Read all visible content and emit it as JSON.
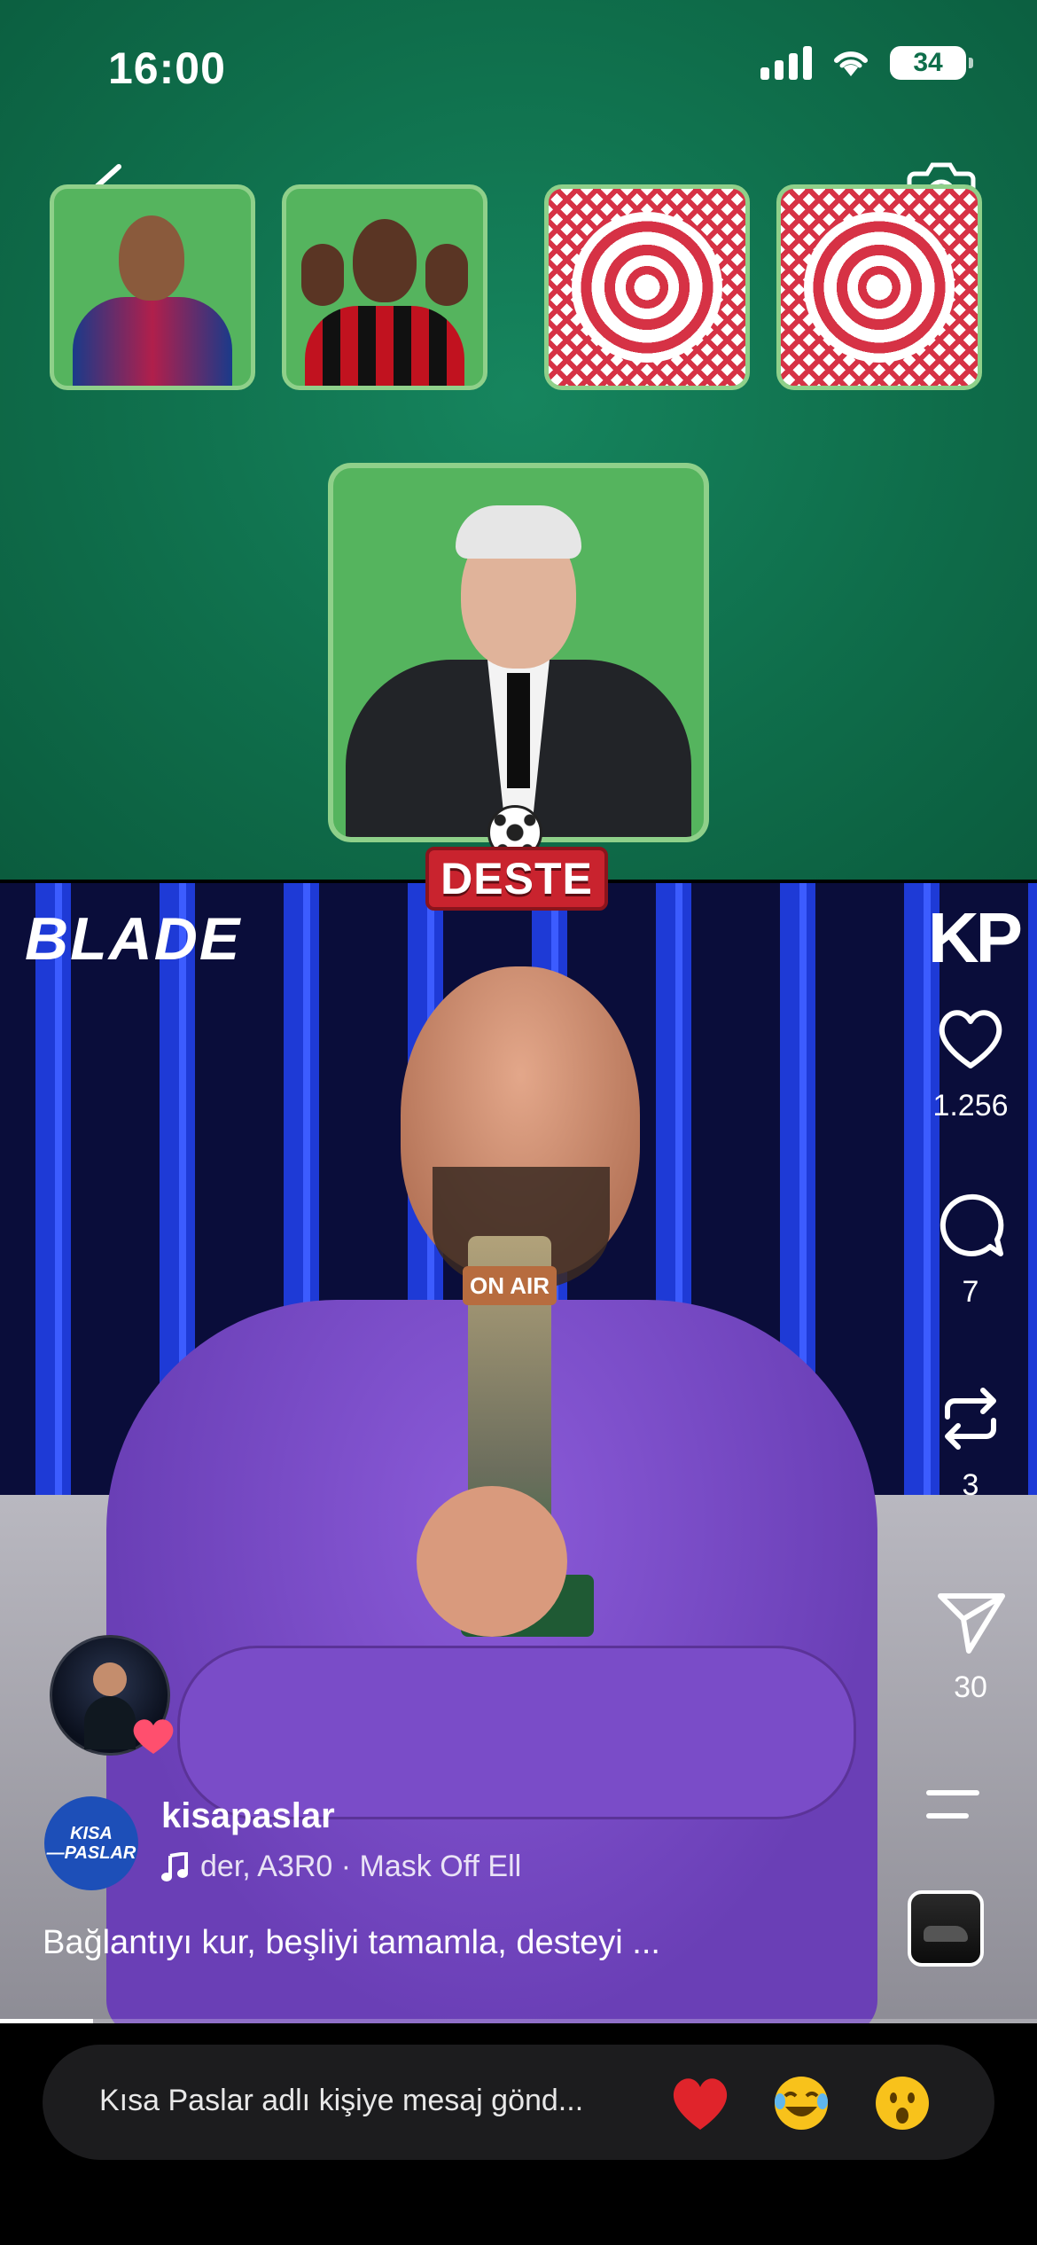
{
  "status_bar": {
    "time": "16:00",
    "battery": "34"
  },
  "game": {
    "logo_text": "DESTE"
  },
  "video": {
    "brand_left": "BLADE",
    "brand_right": "KP",
    "mic_label": "ON AIR"
  },
  "actions": {
    "likes": "1.256",
    "comments": "7",
    "reposts": "3",
    "shares": "30"
  },
  "author": {
    "username": "kisapaslar",
    "avatar_line1": "KISA",
    "avatar_line2": "—PASLAR",
    "music_text": "der, A3R0 · Mask Off    Ell",
    "caption": "Bağlantıyı kur, beşliyi tamamla, desteyi ..."
  },
  "progress": {
    "fraction": 0.09
  },
  "message_bar": {
    "placeholder": "Kısa Paslar adlı kişiye mesaj gönd...",
    "reactions": [
      "heart-emoji",
      "laughing-emoji",
      "surprised-emoji"
    ]
  },
  "colors": {
    "table_green": "#0f6e4b",
    "card_green": "#55b45e",
    "card_border": "#8fd08a",
    "card_back_red": "#d63245",
    "deste_red": "#c9232e"
  }
}
